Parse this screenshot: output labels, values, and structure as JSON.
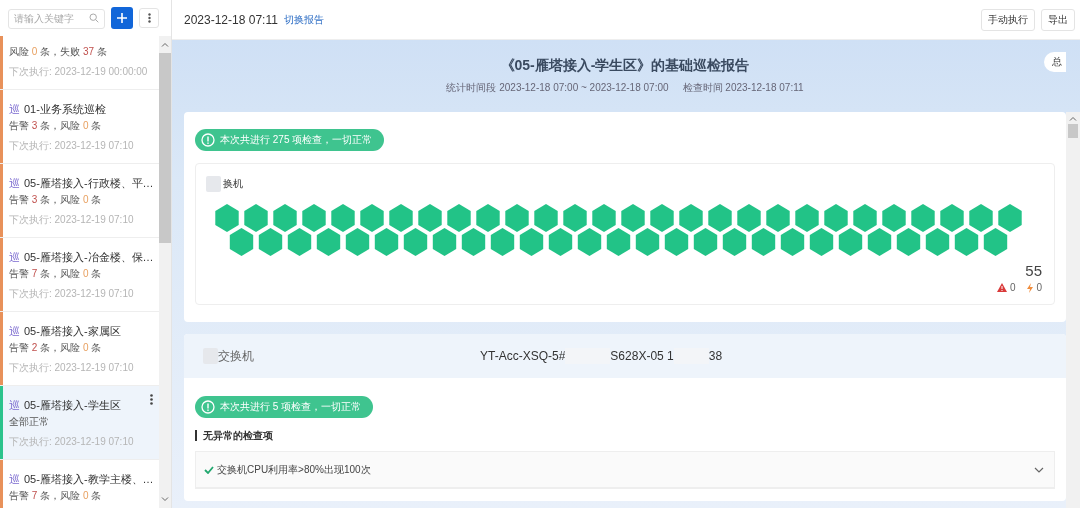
{
  "sidebar": {
    "search": {
      "placeholder": "请输入关键字"
    },
    "items": [
      {
        "segments": [
          {
            "text": "风险 ",
            "kind": "label"
          },
          {
            "text": "0",
            "kind": "risk"
          },
          {
            "text": " 条，失败 ",
            "kind": "label"
          },
          {
            "text": "37",
            "kind": "alert"
          },
          {
            "text": " 条",
            "kind": "label"
          }
        ],
        "next_run": "下次执行: 2023-12-19 00:00:00",
        "color": "#e8915a",
        "selected": false
      },
      {
        "tag": "巡",
        "title": "01-业务系统巡检",
        "segments": [
          {
            "text": "告警 ",
            "kind": "label"
          },
          {
            "text": "3",
            "kind": "alert"
          },
          {
            "text": " 条，风险 ",
            "kind": "label"
          },
          {
            "text": "0",
            "kind": "risk"
          },
          {
            "text": " 条",
            "kind": "label"
          }
        ],
        "next_run": "下次执行: 2023-12-19 07:10",
        "color": "#e8915a",
        "selected": false
      },
      {
        "tag": "巡",
        "title": "05-雁塔接入-行政楼、平…",
        "segments": [
          {
            "text": "告警 ",
            "kind": "label"
          },
          {
            "text": "3",
            "kind": "alert"
          },
          {
            "text": " 条，风险 ",
            "kind": "label"
          },
          {
            "text": "0",
            "kind": "risk"
          },
          {
            "text": " 条",
            "kind": "label"
          }
        ],
        "next_run": "下次执行: 2023-12-19 07:10",
        "color": "#e8915a",
        "selected": false
      },
      {
        "tag": "巡",
        "title": "05-雁塔接入-冶金楼、保…",
        "segments": [
          {
            "text": "告警 ",
            "kind": "label"
          },
          {
            "text": "7",
            "kind": "alert"
          },
          {
            "text": " 条，风险 ",
            "kind": "label"
          },
          {
            "text": "0",
            "kind": "risk"
          },
          {
            "text": " 条",
            "kind": "label"
          }
        ],
        "next_run": "下次执行: 2023-12-19 07:10",
        "color": "#e8915a",
        "selected": false
      },
      {
        "tag": "巡",
        "title": "05-雁塔接入-家属区",
        "segments": [
          {
            "text": "告警 ",
            "kind": "label"
          },
          {
            "text": "2",
            "kind": "alert"
          },
          {
            "text": " 条，风险 ",
            "kind": "label"
          },
          {
            "text": "0",
            "kind": "risk"
          },
          {
            "text": " 条",
            "kind": "label"
          }
        ],
        "next_run": "下次执行: 2023-12-19 07:10",
        "color": "#e8915a",
        "selected": false
      },
      {
        "tag": "巡",
        "title": "05-雁塔接入-学生区",
        "segments": [
          {
            "text": "全部正常",
            "kind": "label"
          }
        ],
        "next_run": "下次执行: 2023-12-19 07:10",
        "color": "#2cc38c",
        "selected": true
      },
      {
        "tag": "巡",
        "title": "05-雁塔接入-教学主楼、…",
        "segments": [
          {
            "text": "告警 ",
            "kind": "label"
          },
          {
            "text": "7",
            "kind": "alert"
          },
          {
            "text": " 条，风险 ",
            "kind": "label"
          },
          {
            "text": "0",
            "kind": "risk"
          },
          {
            "text": " 条",
            "kind": "label"
          }
        ],
        "color": "#e8915a",
        "selected": false
      }
    ]
  },
  "toolbar": {
    "report_time": "2023-12-18 07:11",
    "switch_link": "切换报告",
    "buttons": [
      "手动执行",
      "导出"
    ]
  },
  "banner": {
    "title": "《05-雁塔接入-学生区》的基础巡检报告",
    "period": "统计时间段 2023-12-18 07:00 ~ 2023-12-18 07:00",
    "check_time": "检查时间 2023-12-18 07:11",
    "overview_button": "总"
  },
  "summary": {
    "badge": "本次共进行 275 项检查，一切正常",
    "panel_title": "换机",
    "total": "55",
    "alarm_count": "0",
    "risk_count": "0"
  },
  "device": {
    "name": "交换机",
    "hostname": "YT-Acc-XSQ-5#",
    "model": "S628X-05 1",
    "suffix": "38",
    "badge": "本次共进行 5 项检查，一切正常",
    "section_title": "无异常的检查项",
    "checks": [
      {
        "label": "交换机CPU利用率>80%出现100次"
      }
    ]
  }
}
